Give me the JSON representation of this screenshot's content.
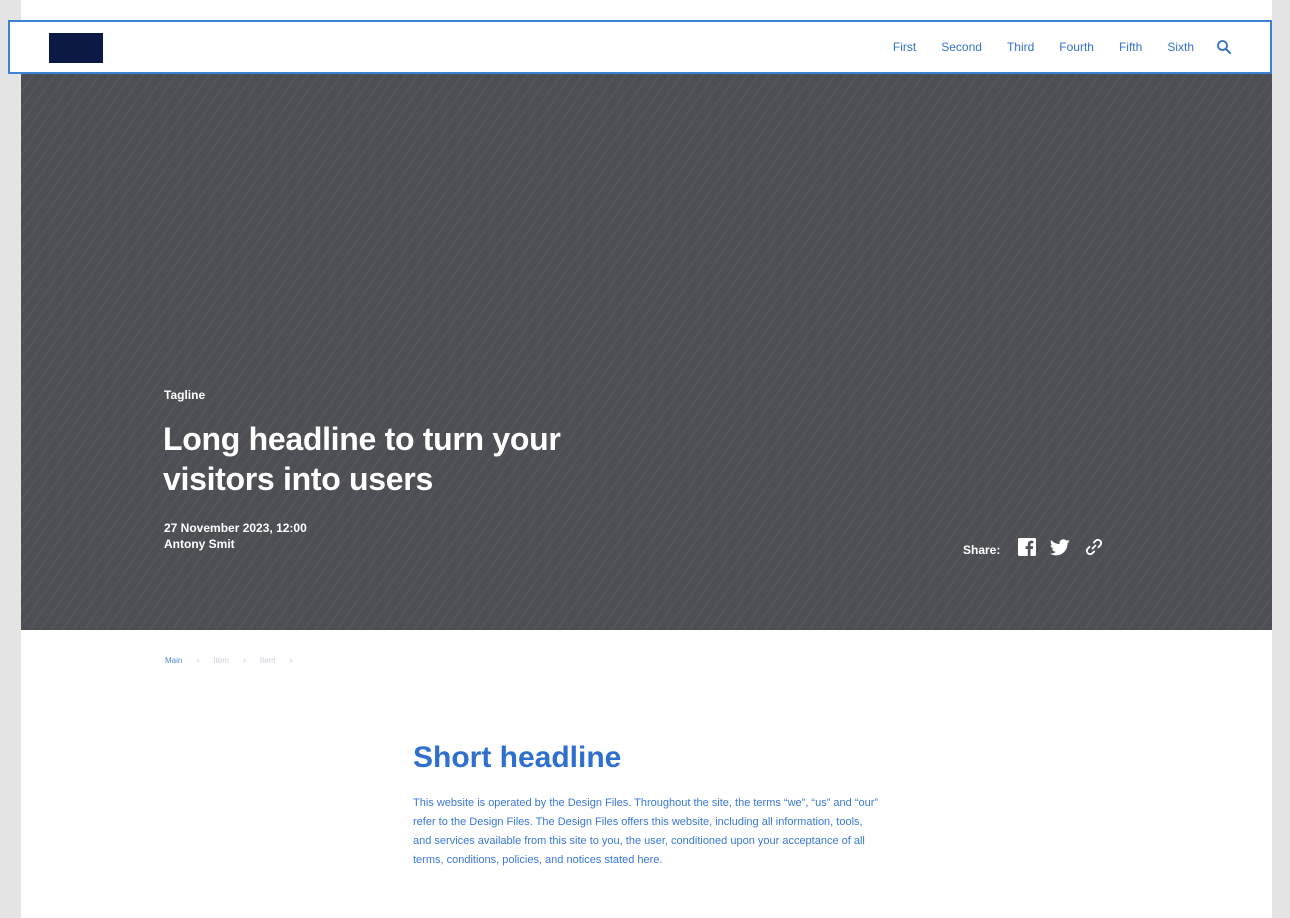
{
  "header": {
    "nav": [
      {
        "label": "First"
      },
      {
        "label": "Second"
      },
      {
        "label": "Third"
      },
      {
        "label": "Fourth"
      },
      {
        "label": "Fifth"
      },
      {
        "label": "Sixth"
      }
    ],
    "search_icon": "search-icon"
  },
  "hero": {
    "tagline": "Tagline",
    "title": "Long headline to turn your visitors into users",
    "date": "27 November 2023, 12:00",
    "author": "Antony Smit",
    "share_label": "Share:",
    "share_icons": [
      "facebook-icon",
      "twitter-icon",
      "link-icon"
    ]
  },
  "breadcrumb": {
    "items": [
      {
        "label": "Main"
      },
      {
        "label": "Item"
      },
      {
        "label": "Item"
      }
    ]
  },
  "content": {
    "title": "Short headline",
    "body": "This website is operated by the Design Files. Throughout the site, the terms “we”, “us” and “our” refer to the Design Files. The Design Files offers this website, including all information, tools, and services available from this site to you, the user, conditioned upon your acceptance of all terms, conditions, policies, and notices stated here."
  },
  "colors": {
    "header_border": "#3b82d6",
    "logo": "#0b1a44",
    "nav_text": "#3572c9",
    "hero_bg": "#4d4f54",
    "content_title": "#2f6fcf",
    "content_body": "#3a78d8"
  }
}
